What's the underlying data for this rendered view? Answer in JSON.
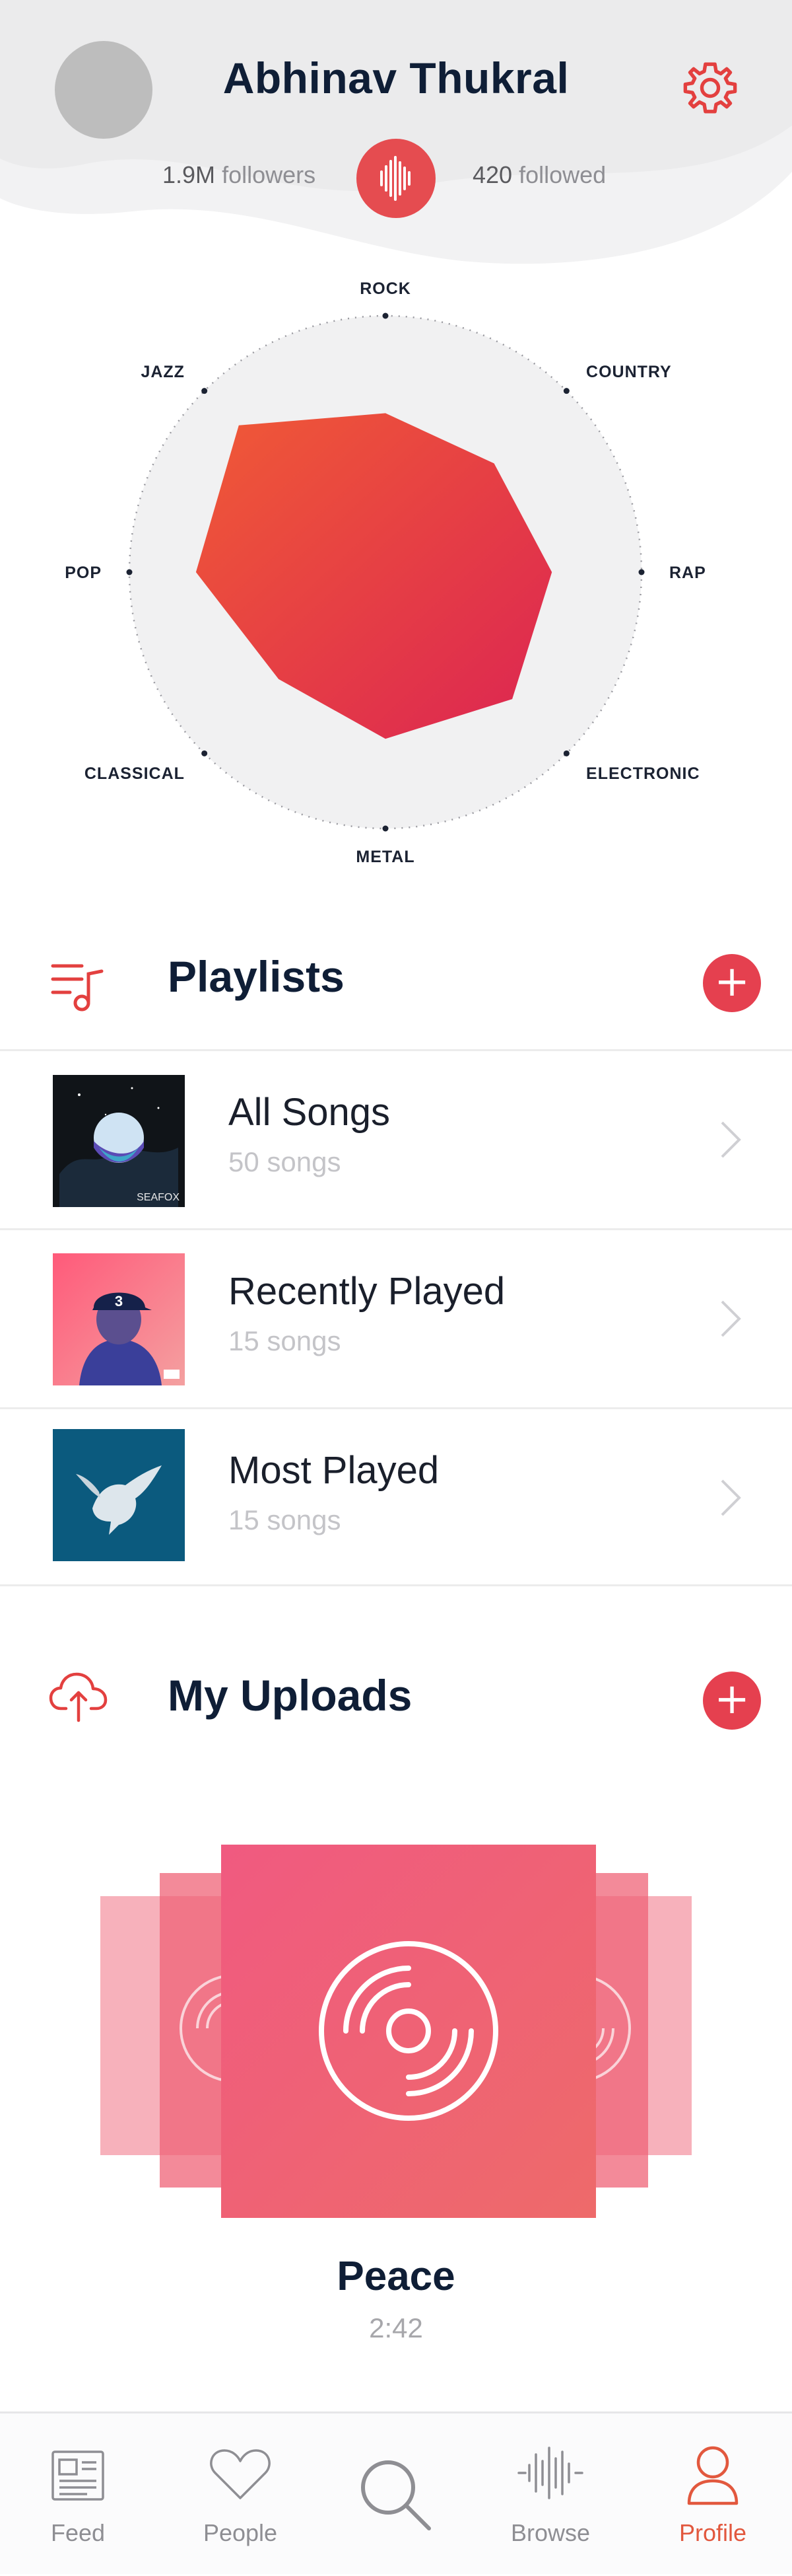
{
  "profile": {
    "name": "Abhinav Thukral",
    "followers_count": "1.9M",
    "followers_label": "followers",
    "followed_count": "420",
    "followed_label": "followed"
  },
  "genres": {
    "labels": [
      "ROCK",
      "COUNTRY",
      "RAP",
      "ELECTRONIC",
      "METAL",
      "CLASSICAL",
      "POP",
      "JAZZ"
    ],
    "values": [
      0.62,
      0.6,
      0.65,
      0.7,
      0.65,
      0.59,
      0.74,
      0.81
    ]
  },
  "playlists": {
    "title": "Playlists",
    "items": [
      {
        "title": "All Songs",
        "subtitle": "50 songs",
        "art_caption": "SEAFOX"
      },
      {
        "title": "Recently Played",
        "subtitle": "15 songs",
        "art_caption": "3"
      },
      {
        "title": "Most Played",
        "subtitle": "15 songs",
        "art_caption": ""
      }
    ]
  },
  "uploads": {
    "title": "My Uploads",
    "current_song": "Peace",
    "current_duration": "2:42"
  },
  "tabs": [
    {
      "label": "Feed",
      "icon": "newspaper-icon"
    },
    {
      "label": "People",
      "icon": "heart-icon"
    },
    {
      "label": "",
      "icon": "search-icon"
    },
    {
      "label": "Browse",
      "icon": "soundwave-icon"
    },
    {
      "label": "Profile",
      "icon": "person-icon",
      "active": true
    }
  ],
  "colors": {
    "accent": "#e5404f",
    "radar_start": "#f05a36",
    "radar_end": "#dc2552",
    "upload_card": "#ef6377",
    "title_text": "#0f1e36"
  }
}
